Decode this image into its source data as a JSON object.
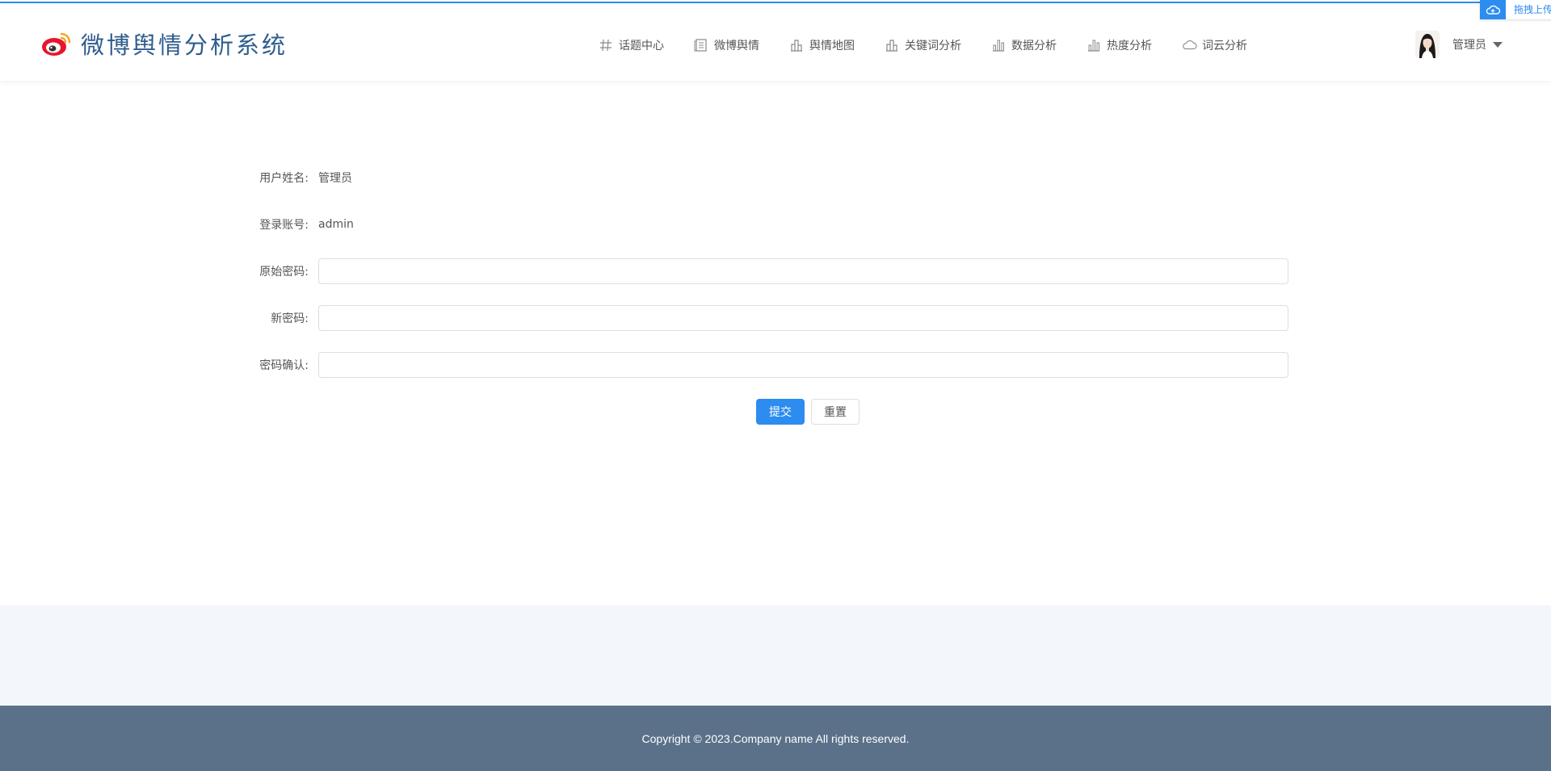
{
  "header": {
    "title": "微博舆情分析系统",
    "nav": [
      {
        "label": "话题中心",
        "icon": "hash-icon"
      },
      {
        "label": "微博舆情",
        "icon": "document-icon"
      },
      {
        "label": "舆情地图",
        "icon": "building-icon"
      },
      {
        "label": "关键词分析",
        "icon": "building-icon"
      },
      {
        "label": "数据分析",
        "icon": "bar-chart-icon"
      },
      {
        "label": "热度分析",
        "icon": "bar-chart-icon"
      },
      {
        "label": "词云分析",
        "icon": "cloud-icon"
      }
    ],
    "user": {
      "name": "管理员"
    },
    "upload_widget": {
      "label": "拖拽上传"
    }
  },
  "form": {
    "username_label": "用户姓名:",
    "username_value": "管理员",
    "account_label": "登录账号:",
    "account_value": "admin",
    "old_password_label": "原始密码:",
    "old_password_value": "",
    "new_password_label": "新密码:",
    "new_password_value": "",
    "confirm_password_label": "密码确认:",
    "confirm_password_value": "",
    "submit_label": "提交",
    "reset_label": "重置"
  },
  "footer": {
    "copyright": "Copyright © 2023.Company name All rights reserved."
  },
  "colors": {
    "accent": "#2d8cf0",
    "brand_text": "#2f5d8e",
    "footer_bg": "#5a7189",
    "band_bg": "#f3f6fb"
  }
}
